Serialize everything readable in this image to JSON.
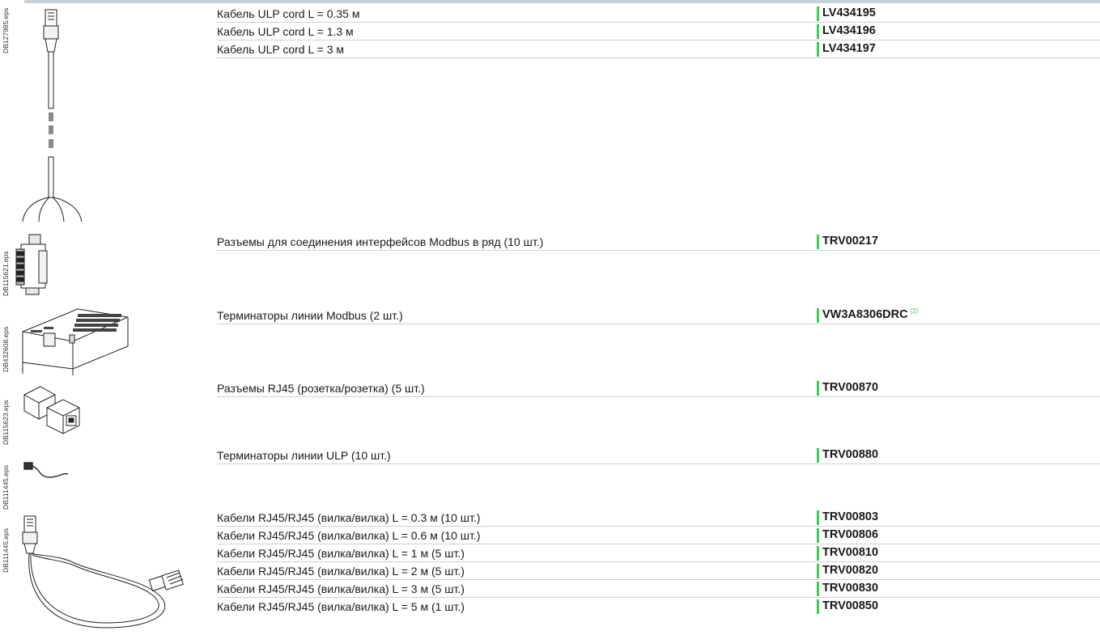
{
  "image_labels": {
    "cord_img": "DB127985.eps",
    "connector_img": "DB115621.eps",
    "terminator_modbus_img": "DB432608.eps",
    "rj45_coupler_img": "DB115623.eps",
    "terminator_ulp_img": "DB111445.eps",
    "rj45_cable_img": "DB111445.eps"
  },
  "rows": [
    {
      "desc": "Кабель ULP cord L = 0.35 м",
      "ref": "LV434195",
      "note": ""
    },
    {
      "desc": "Кабель ULP cord L = 1.3 м",
      "ref": "LV434196",
      "note": ""
    },
    {
      "desc": "Кабель ULP cord L = 3 м",
      "ref": "LV434197",
      "note": ""
    },
    {
      "desc": "Разъемы для соединения интерфейсов Modbus в ряд (10 шт.)",
      "ref": "TRV00217",
      "note": ""
    },
    {
      "desc": "Терминаторы линии Modbus (2 шт.)",
      "ref": "VW3A8306DRC",
      "note": "(2)"
    },
    {
      "desc": "Разъемы RJ45 (розетка/розетка) (5 шт.)",
      "ref": "TRV00870",
      "note": ""
    },
    {
      "desc": "Терминаторы линии ULP (10 шт.)",
      "ref": "TRV00880",
      "note": ""
    },
    {
      "desc": "Кабели RJ45/RJ45 (вилка/вилка) L = 0.3 м (10 шт.)",
      "ref": "TRV00803",
      "note": ""
    },
    {
      "desc": "Кабели RJ45/RJ45 (вилка/вилка) L = 0.6 м (10 шт.)",
      "ref": "TRV00806",
      "note": ""
    },
    {
      "desc": "Кабели RJ45/RJ45 (вилка/вилка) L = 1 м (5 шт.)",
      "ref": "TRV00810",
      "note": ""
    },
    {
      "desc": "Кабели RJ45/RJ45 (вилка/вилка) L = 2 м (5 шт.)",
      "ref": "TRV00820",
      "note": ""
    },
    {
      "desc": "Кабели RJ45/RJ45 (вилка/вилка) L = 3 м (5 шт.)",
      "ref": "TRV00830",
      "note": ""
    },
    {
      "desc": "Кабели RJ45/RJ45 (вилка/вилка) L = 5 м (1 шт.)",
      "ref": "TRV00850",
      "note": ""
    }
  ],
  "colors": {
    "accent": "#3dcd58",
    "rule": "#cfcfcf",
    "header_bar": "#c8d3d9"
  },
  "icons": [
    "ulp-cord-illustration",
    "modbus-connector-illustration",
    "modbus-terminator-illustration",
    "rj45-coupler-illustration",
    "ulp-terminator-illustration",
    "rj45-cable-illustration"
  ]
}
